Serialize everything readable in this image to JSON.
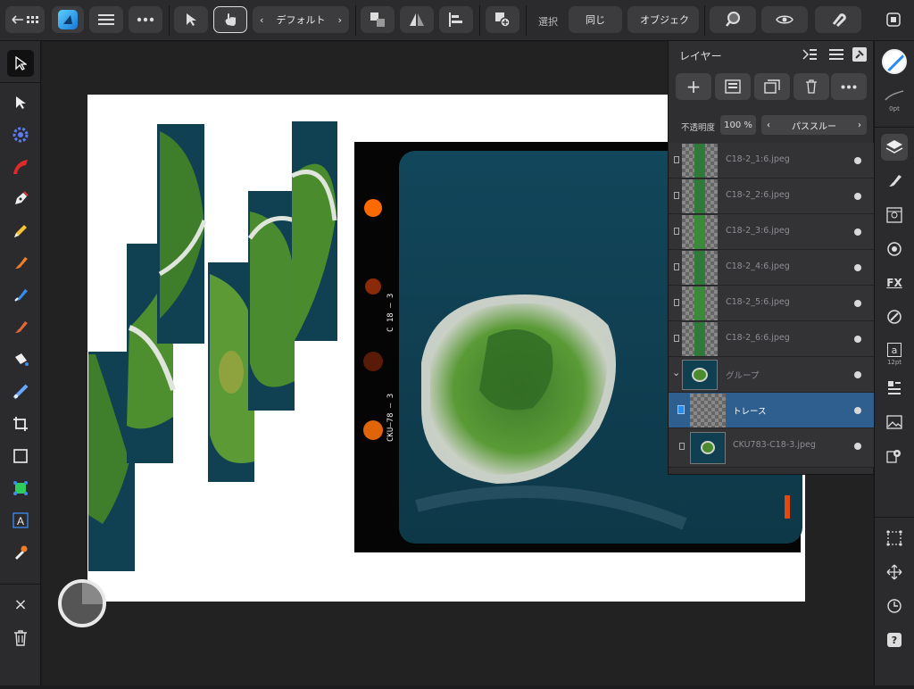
{
  "toolbar": {
    "style_label": "デフォルト",
    "select_label": "選択",
    "same_label": "同じ",
    "object_label": "オブジェク"
  },
  "layers_panel": {
    "title": "レイヤー",
    "opacity_label": "不透明度",
    "opacity_value": "100 %",
    "blend_mode": "パススルー",
    "layers": [
      {
        "name": "C18-2_1:6.jpeg"
      },
      {
        "name": "C18-2_2:6.jpeg"
      },
      {
        "name": "C18-2_3:6.jpeg"
      },
      {
        "name": "C18-2_4:6.jpeg"
      },
      {
        "name": "C18-2_5:6.jpeg"
      },
      {
        "name": "C18-2_6:6.jpeg"
      },
      {
        "name": "グループ"
      },
      {
        "name": "トレース"
      },
      {
        "name": "CKU783-C18-3.jpeg"
      }
    ]
  },
  "right_toolbar": {
    "stroke_width": "0pt",
    "text_size": "12pt"
  },
  "film_marks": {
    "code_top": "C 18 — 3",
    "code_bottom": "CKU—78 — 3"
  },
  "colors": {
    "selection_blue": "#2f5f8f",
    "accent_blue": "#2a8cf0",
    "panel_bg": "#2f2f31",
    "toolbar_bg": "#2b2b2d"
  }
}
